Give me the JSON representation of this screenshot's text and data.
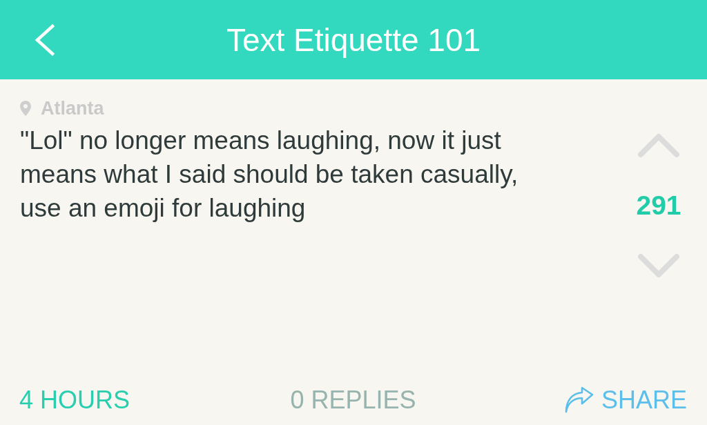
{
  "header": {
    "title": "Text Etiquette 101"
  },
  "post": {
    "location": "Atlanta",
    "message": "\"Lol\" no longer means laughing, now it just means what I said should be taken casually, use an emoji for laughing",
    "votes": "291"
  },
  "footer": {
    "time": "4 HOURS",
    "replies": "0 REPLIES",
    "share": "SHARE"
  }
}
